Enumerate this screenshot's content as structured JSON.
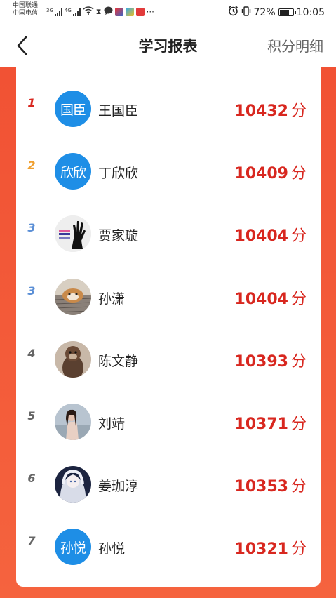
{
  "status_bar": {
    "carrier1": "中国联通",
    "carrier2": "中国电信",
    "net1": "3G",
    "net2": "4G",
    "battery_text": "72%",
    "battery_level": 0.72,
    "time": "10:05",
    "more": "···"
  },
  "header": {
    "title": "学习报表",
    "right_link": "积分明细"
  },
  "colors": {
    "accent_red": "#d8271f",
    "background_red": "#f15234",
    "avatar_blue": "#1e8ee6",
    "rank1": "#d8271f",
    "rank2": "#f0a030",
    "rank3": "#5b8fd6",
    "rank_other": "#666666"
  },
  "unit": "分",
  "rankings": [
    {
      "rank": "1",
      "name": "王国臣",
      "score": "10432",
      "avatar_text": "国臣",
      "avatar": "text"
    },
    {
      "rank": "2",
      "name": "丁欣欣",
      "score": "10409",
      "avatar_text": "欣欣",
      "avatar": "text"
    },
    {
      "rank": "3",
      "name": "贾家璇",
      "score": "10404",
      "avatar_text": "",
      "avatar": "hand-photo"
    },
    {
      "rank": "3",
      "name": "孙潇",
      "score": "10404",
      "avatar_text": "",
      "avatar": "dog-photo"
    },
    {
      "rank": "4",
      "name": "陈文静",
      "score": "10393",
      "avatar_text": "",
      "avatar": "otter-photo"
    },
    {
      "rank": "5",
      "name": "刘靖",
      "score": "10371",
      "avatar_text": "",
      "avatar": "girl-photo"
    },
    {
      "rank": "6",
      "name": "姜珈淳",
      "score": "10353",
      "avatar_text": "",
      "avatar": "anime-photo"
    },
    {
      "rank": "7",
      "name": "孙悦",
      "score": "10321",
      "avatar_text": "孙悦",
      "avatar": "text"
    }
  ]
}
